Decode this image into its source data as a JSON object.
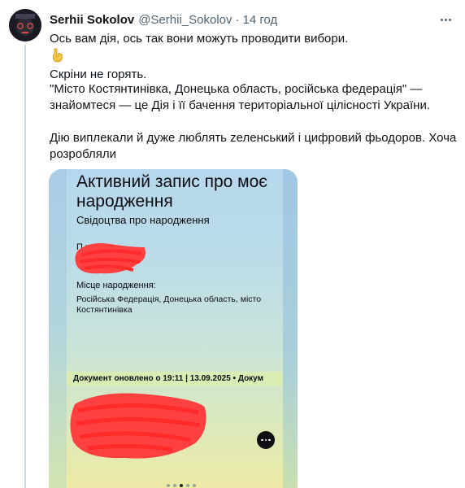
{
  "tweet": {
    "author": {
      "name": "Serhii Sokolov",
      "handle": "@Serhii_Sokolov",
      "separator": "·",
      "time": "14 год"
    },
    "text": {
      "line1": "Ось вам дія, ось так вони можуть проводити вибори.",
      "emoji_icon": "pointing-down-emoji",
      "line3": "Скріни не горять.",
      "line4": "\"Місто Костянтинівка, Донецька область, російська федерація\" —",
      "line5": "знайомтеся — це Дія і її бачення територіальної цілісності України.",
      "line6": "Дію виплекали й дуже люблять zеленський і цифровий фьодоров. Хоча",
      "line7": "розробляли"
    },
    "media": {
      "card_title": "Активний запис про моє народження",
      "card_subtitle": "Свідоцтва про народження",
      "label_name": "П        ження:",
      "label_place": "Місце народження:",
      "value_place": "Російська Федерація, Донецька область, місто Костянтинівка",
      "update_text": "Документ оновлено о 19:11 | 13.09.2025 • Докум",
      "carousel_pages": 5,
      "carousel_active_index": 2
    },
    "colors": {
      "redaction": "#ff3b3b",
      "name_text": "#0f1419",
      "secondary_text": "#536471"
    }
  }
}
